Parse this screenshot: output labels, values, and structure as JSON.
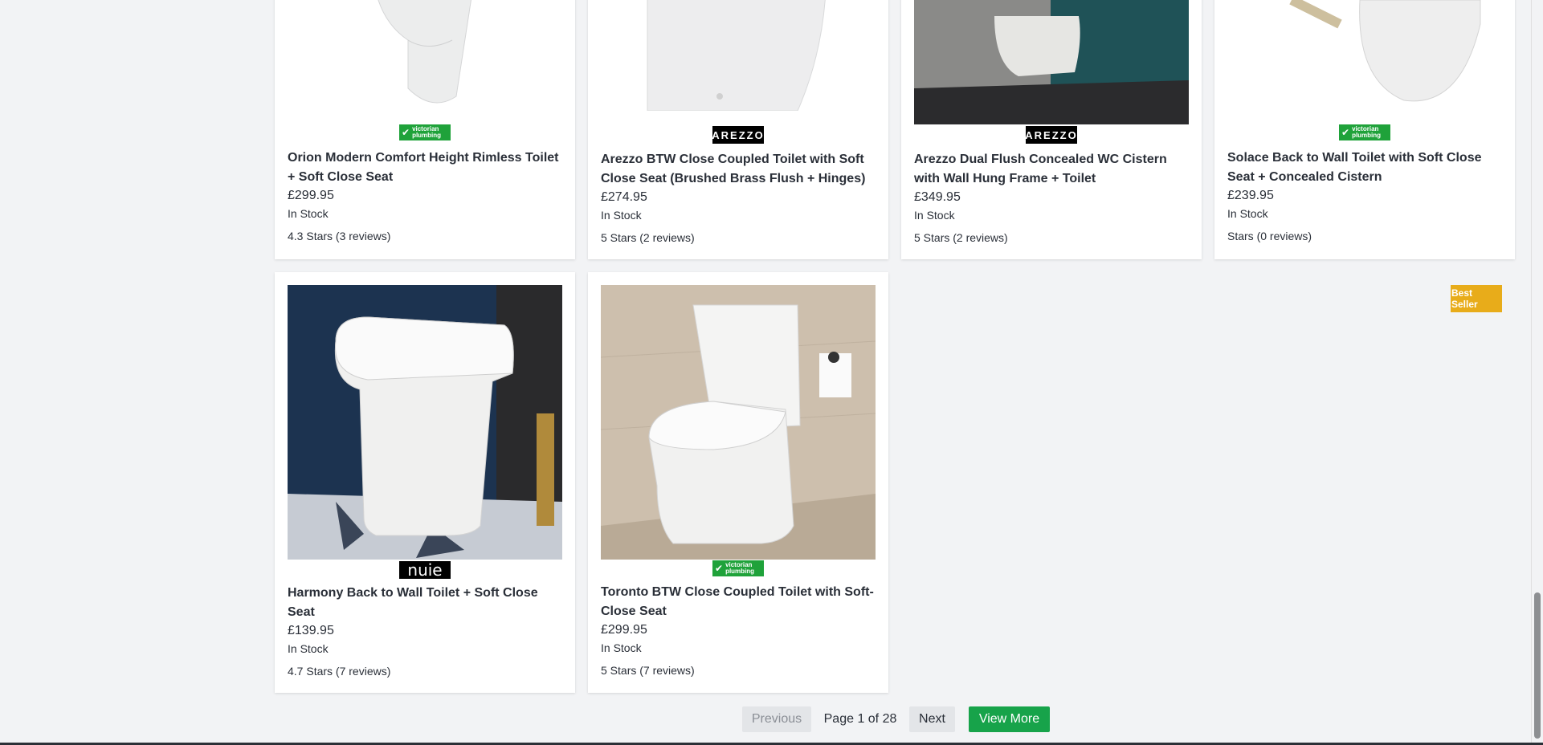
{
  "products": [
    {
      "brand": "victorian plumbing",
      "title": "Orion Modern Comfort Height Rimless Toilet + Soft Close Seat",
      "price": "£299.95",
      "stock": "In Stock",
      "reviews": "4.3 Stars (3 reviews)"
    },
    {
      "brand": "ARREZZO",
      "title": "Arezzo BTW Close Coupled Toilet with Soft Close Seat (Brushed Brass Flush + Hinges)",
      "price": "£274.95",
      "stock": "In Stock",
      "reviews": "5 Stars (2 reviews)"
    },
    {
      "brand": "ARREZZO",
      "title": "Arezzo Dual Flush Concealed WC Cistern with Wall Hung Frame + Toilet",
      "price": "£349.95",
      "stock": "In Stock",
      "reviews": "5 Stars (2 reviews)"
    },
    {
      "brand": "victorian plumbing",
      "title": "Solace Back to Wall Toilet with Soft Close Seat + Concealed Cistern",
      "price": "£239.95",
      "stock": "In Stock",
      "reviews": "Stars (0 reviews)"
    },
    {
      "brand": "nuie",
      "title": "Harmony Back to Wall Toilet + Soft Close Seat",
      "price": "£139.95",
      "stock": "In Stock",
      "reviews": "4.7 Stars (7 reviews)"
    },
    {
      "brand": "victorian plumbing",
      "title": "Toronto BTW Close Coupled Toilet with Soft-Close Seat",
      "price": "£299.95",
      "stock": "In Stock",
      "reviews": "5 Stars (7 reviews)"
    }
  ],
  "badge": "Best Seller",
  "pagination": {
    "previous": "Previous",
    "page_info": "Page 1 of 28",
    "next": "Next",
    "view_more": "View More"
  },
  "colors": {
    "accent_green": "#17a34a",
    "badge": "#e8ac1a",
    "brand_green": "#1fa23a"
  }
}
